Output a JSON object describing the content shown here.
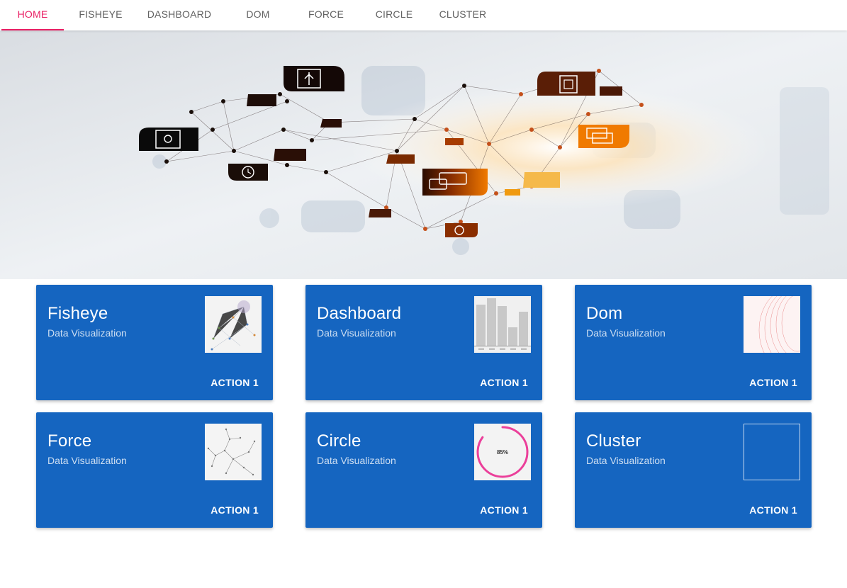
{
  "tabs": [
    {
      "label": "HOME",
      "active": true
    },
    {
      "label": "FISHEYE",
      "active": false
    },
    {
      "label": "DASHBOARD",
      "active": false
    },
    {
      "label": "DOM",
      "active": false
    },
    {
      "label": "FORCE",
      "active": false
    },
    {
      "label": "CIRCLE",
      "active": false
    },
    {
      "label": "CLUSTER",
      "active": false
    }
  ],
  "colors": {
    "accent": "#e91e63",
    "card_background": "#1565c0",
    "tab_text": "#616161"
  },
  "hero": {
    "icons": [
      "usb-icon",
      "tablet-icon",
      "alarm-clock-icon",
      "chat-icon",
      "gear-icon",
      "device-icon",
      "windows-icon",
      "calculator-icon",
      "cloud-upload-icon"
    ]
  },
  "cards": [
    {
      "title": "Fisheye",
      "subtitle": "Data Visualization",
      "action": "ACTION 1",
      "thumb": "fisheye-thumbnail"
    },
    {
      "title": "Dashboard",
      "subtitle": "Data Visualization",
      "action": "ACTION 1",
      "thumb": "dashboard-thumbnail"
    },
    {
      "title": "Dom",
      "subtitle": "Data Visualization",
      "action": "ACTION 1",
      "thumb": "dom-thumbnail"
    },
    {
      "title": "Force",
      "subtitle": "Data Visualization",
      "action": "ACTION 1",
      "thumb": "force-thumbnail"
    },
    {
      "title": "Circle",
      "subtitle": "Data Visualization",
      "action": "ACTION 1",
      "thumb": "circle-thumbnail",
      "progress_label": "85%",
      "progress": 0.85
    },
    {
      "title": "Cluster",
      "subtitle": "Data Visualization",
      "action": "ACTION 1",
      "thumb": "cluster-thumbnail"
    }
  ]
}
